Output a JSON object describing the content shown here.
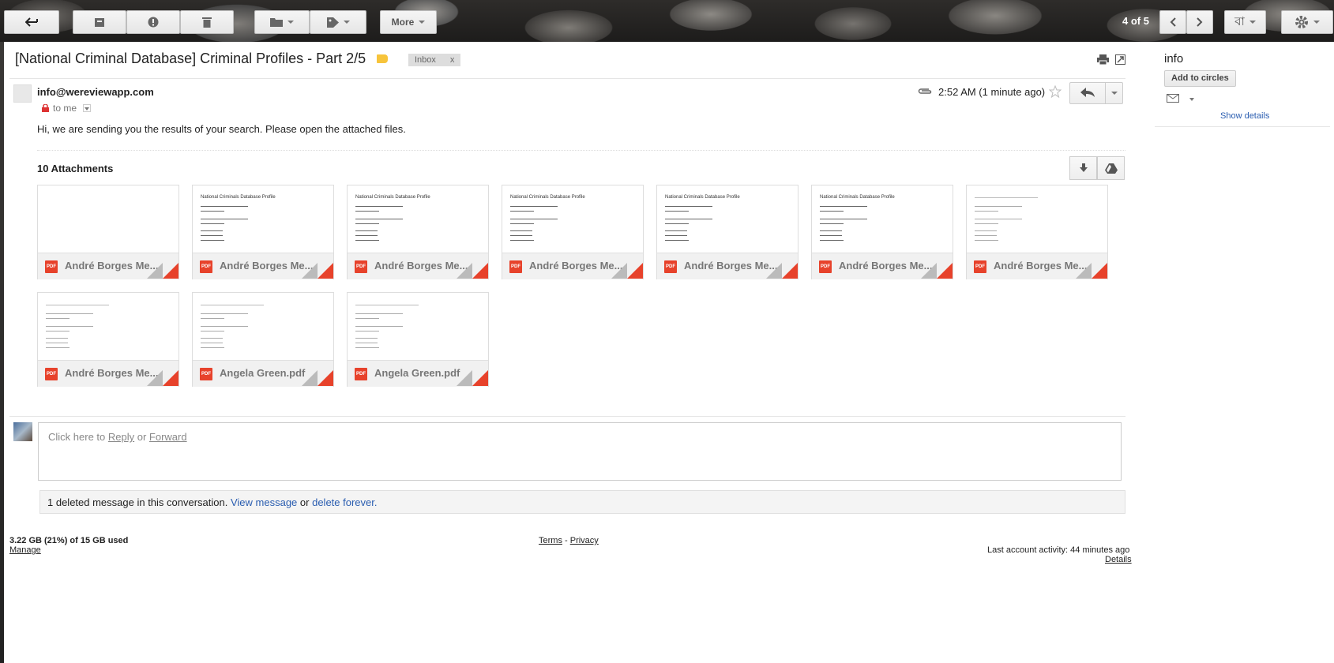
{
  "toolbar": {
    "more_label": "More",
    "pager": "4 of 5",
    "language_label": "বা"
  },
  "message": {
    "subject": "[National Criminal Database] Criminal Profiles - Part 2/5",
    "label_chip": "Inbox",
    "label_remove": "x",
    "sender": "info@wereviewapp.com",
    "recipient": "to me",
    "time": "2:52 AM (1 minute ago)",
    "body": "Hi, we are sending you the results of your search. Please open the attached files."
  },
  "attachments": {
    "title": "10 Attachments",
    "items": [
      {
        "name": "André Borges Me...",
        "type": "PDF",
        "preview_title": "",
        "blank": true
      },
      {
        "name": "André Borges Me...",
        "type": "PDF",
        "preview_title": "National Criminals Database Profile"
      },
      {
        "name": "André Borges Me...",
        "type": "PDF",
        "preview_title": "National Criminals Database Profile"
      },
      {
        "name": "André Borges Me...",
        "type": "PDF",
        "preview_title": "National Criminals Database Profile"
      },
      {
        "name": "André Borges Me...",
        "type": "PDF",
        "preview_title": "National Criminals Database Profile"
      },
      {
        "name": "André Borges Me...",
        "type": "PDF",
        "preview_title": "National Criminals Database Profile"
      },
      {
        "name": "André Borges Me...",
        "type": "PDF",
        "preview_title": ""
      },
      {
        "name": "André Borges Me...",
        "type": "PDF",
        "preview_title": ""
      },
      {
        "name": "Angela Green.pdf",
        "type": "PDF",
        "preview_title": ""
      },
      {
        "name": "Angela Green.pdf",
        "type": "PDF",
        "preview_title": ""
      }
    ]
  },
  "reply": {
    "prefix": "Click here to ",
    "reply_link": "Reply",
    "or": " or ",
    "forward_link": "Forward"
  },
  "deleted": {
    "text": "1 deleted message in this conversation.",
    "view_link": "View message",
    "or": " or ",
    "delete_link": "delete forever."
  },
  "footer": {
    "quota": "3.22 GB (21%) of 15 GB used",
    "manage": "Manage",
    "terms": "Terms",
    "dash": " - ",
    "privacy": "Privacy",
    "activity": "Last account activity: 44 minutes ago",
    "details": "Details"
  },
  "contact_panel": {
    "name": "info",
    "add_button": "Add to circles",
    "show_details": "Show details"
  },
  "colors": {
    "link": "#2a5db0",
    "pdf_red": "#e7422b",
    "label_yellow": "#f7c43b"
  }
}
